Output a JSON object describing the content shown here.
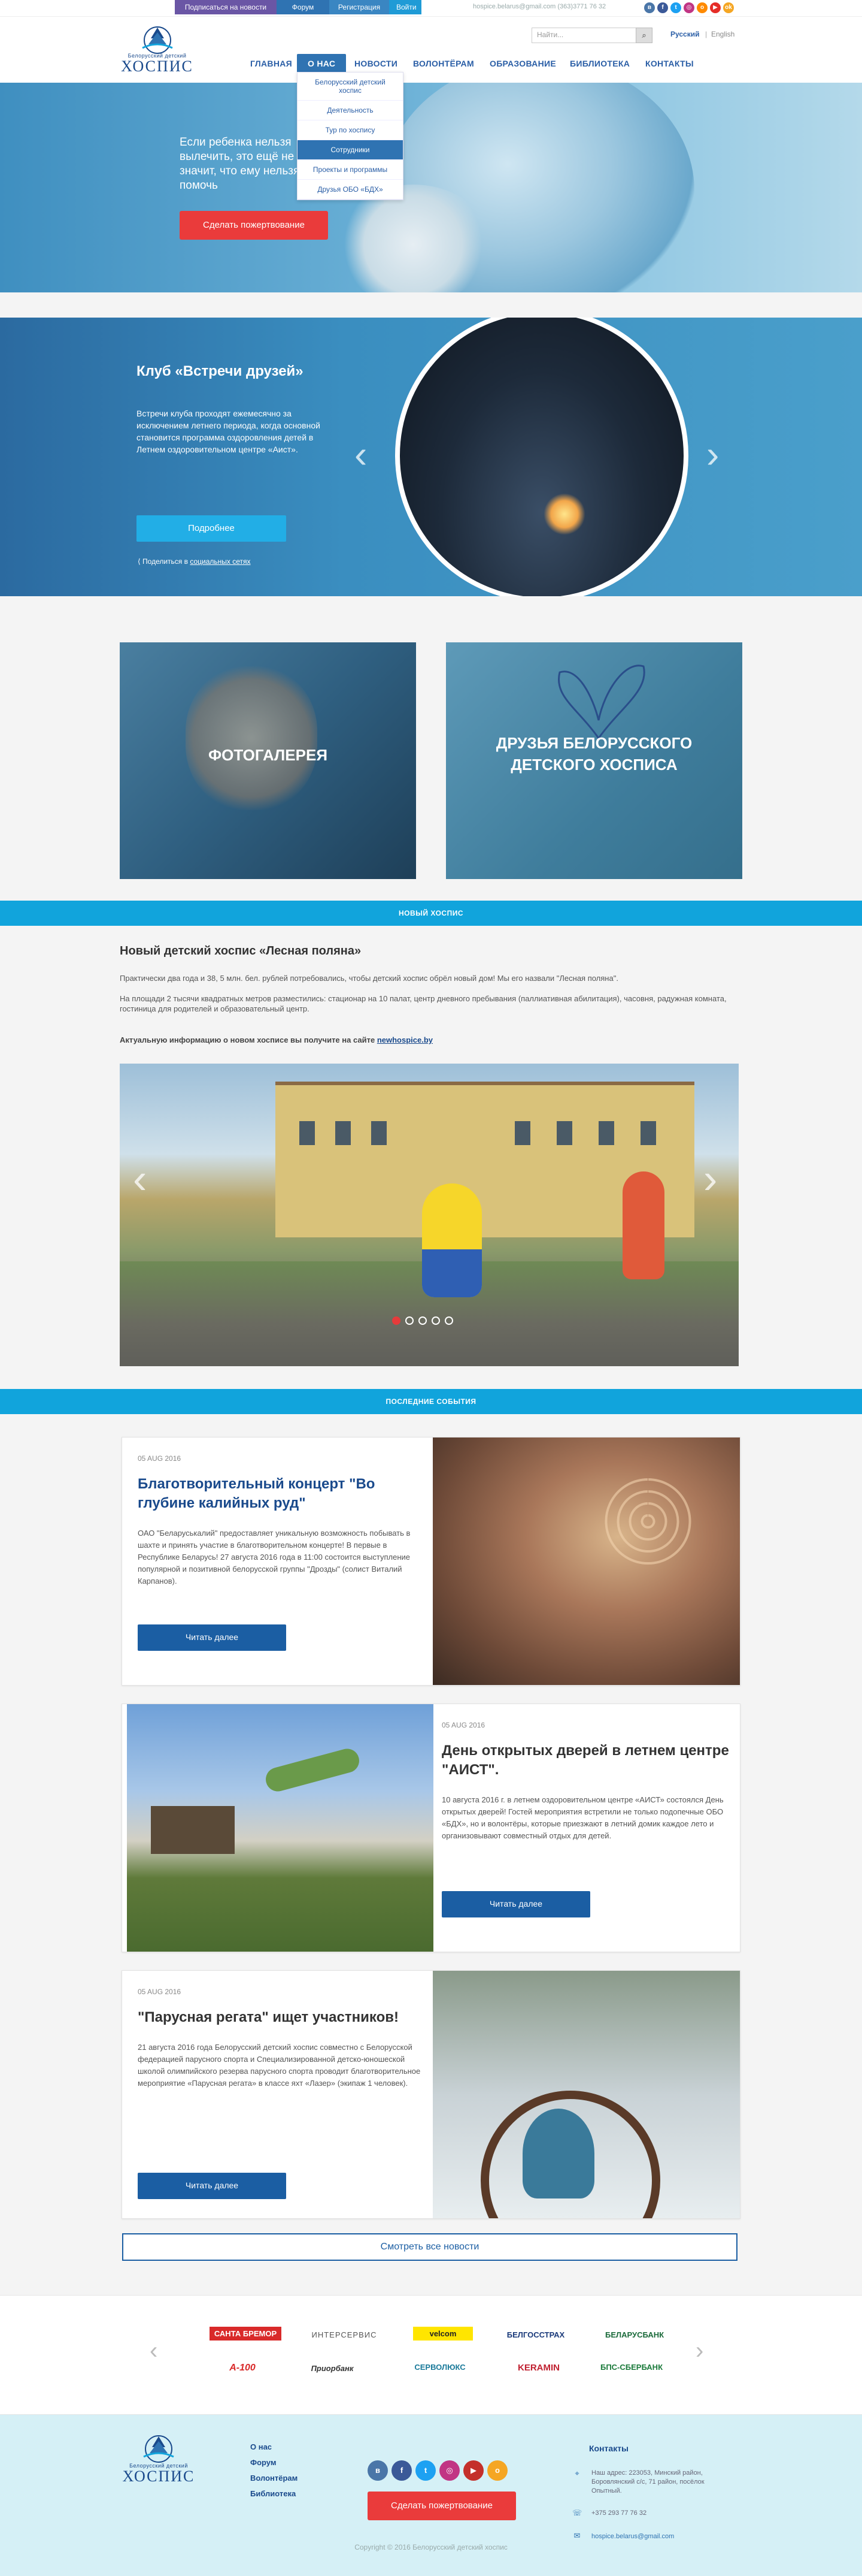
{
  "topbar": {
    "subscribe": "Подписаться на новости",
    "forum": "Форум",
    "register": "Регистрация",
    "login": "Войти",
    "contact": "hospice.belarus@gmail.com  (363)3771 76 32",
    "social": [
      "vk",
      "fb",
      "tw",
      "in",
      "od",
      "yt",
      "ok"
    ]
  },
  "header": {
    "logo_small": "Белорусский детский",
    "logo_big": "ХОСПИС",
    "search_placeholder": "Найти...",
    "lang_ru": "Русский",
    "lang_en": "English",
    "nav": [
      "Главная",
      "О нас",
      "Новости",
      "Волонтёрам",
      "Образование",
      "Библиотека",
      "Контакты"
    ]
  },
  "dropdown": [
    "Белорусский детский хоспис",
    "Деятельность",
    "Тур по хоспису",
    "Сотрудники",
    "Проекты и программы",
    "Друзья ОБО «БДХ»"
  ],
  "hero": {
    "text": "Если ребенка нельзя вылечить, это ещё не значит, что ему нельзя помочь",
    "donate": "Сделать пожертвование"
  },
  "club": {
    "title": "Клуб «Встречи друзей»",
    "text": "Встречи клуба проходят ежемесячно за исключением летнего периода, когда основной становится программа оздоровления детей в Летнем оздоровительном центре «Аист».",
    "more": "Подробнее",
    "share_prefix": "Поделиться в",
    "share_link": "социальных сетях"
  },
  "tiles": {
    "gallery": "Фотогалерея",
    "friends": "Друзья белорусского детского хосписа"
  },
  "newhospice": {
    "band": "Новый хоспис",
    "title": "Новый детский хоспис «Лесная поляна»",
    "p1": "Практически два года и 38, 5 млн. бел. рублей потребовались, чтобы детский хоспис обрёл новый дом! Мы его назвали \"Лесная поляна\".",
    "p2": "На площади 2 тысячи квадратных метров разместились: стационар на 10 палат, центр дневного пребывания (паллиативная абилитация), часовня, радужная комната, гостиница для родителей и образовательный центр.",
    "p3_prefix": "Актуальную информацию о новом хосписе вы получите на сайте",
    "p3_link": "newhospice.by",
    "slide_count": 5,
    "active_slide": 1
  },
  "events": {
    "band": "Последние события",
    "items": [
      {
        "date": "05 AUG 2016",
        "title": "Благотворительный концерт \"Во глубине калийных руд\"",
        "body": "ОАО \"Беларуськалий\" предоставляет уникальную возможность побывать в шахте и принять участие в благотворительном концерте! В первые в Республике Беларусь! 27 августа 2016 года в 11:00 состоится выступление популярной и позитивной белорусской группы \"Дрозды\" (солист Виталий Карпанов).",
        "button": "Читать далее"
      },
      {
        "date": "05 AUG 2016",
        "title": "День открытых дверей в летнем центре \"АИСТ\".",
        "body": "10 августа 2016 г. в летнем оздоровительном центре «АИСТ» состоялся День открытых дверей! Гостей мероприятия встретили не только подопечные ОБО «БДХ», но и волонтёры, которые приезжают в летний домик каждое лето и организовывают совместный отдых для детей.",
        "button": "Читать далее"
      },
      {
        "date": "05 AUG 2016",
        "title": "\"Парусная регата\" ищет участников!",
        "body": "21 августа 2016 года Белорусский детский хоспис совместно с Белорусской федерацией парусного спорта и Специализированной детско-юношеской школой олимпийского резерва парусного спорта проводит благотворительное мероприятие «Парусная регата» в классе яхт «Лазер» (экипаж 1 человек).",
        "button": "Читать далее"
      }
    ],
    "all_news": "Смотреть все новости"
  },
  "partners": [
    "САНТА БРЕМОР",
    "ИНТЕРСЕРВИС",
    "velcom",
    "БЕЛГОССТРАХ",
    "БЕЛАРУСБАНК",
    "A-100",
    "Приорбанк",
    "СЕРВОЛЮКС",
    "KERAMIN",
    "БПС-СБЕРБАНК"
  ],
  "footer": {
    "logo_small": "Белорусский детский",
    "logo_big": "ХОСПИС",
    "links": [
      "О нас",
      "Форум",
      "Волонтёрам",
      "Библиотека"
    ],
    "social": [
      "vk",
      "f",
      "t",
      "in",
      "yt",
      "ok"
    ],
    "donate": "Сделать пожертвование",
    "contacts_title": "Контакты",
    "address": "Наш адрес: 223053, Минский район, Боровлянский с/с, 71 район, посёлок Опытный.",
    "phone": "+375 293 77 76 32",
    "email": "hospice.belarus@gmail.com",
    "copyright": "Copyright © 2016 Белорусский детский хоспис"
  },
  "colors": {
    "brand_blue": "#1a4a8c",
    "accent_cyan": "#11a4dc",
    "donate_red": "#ea3b3b",
    "purple": "#6a56a5"
  }
}
